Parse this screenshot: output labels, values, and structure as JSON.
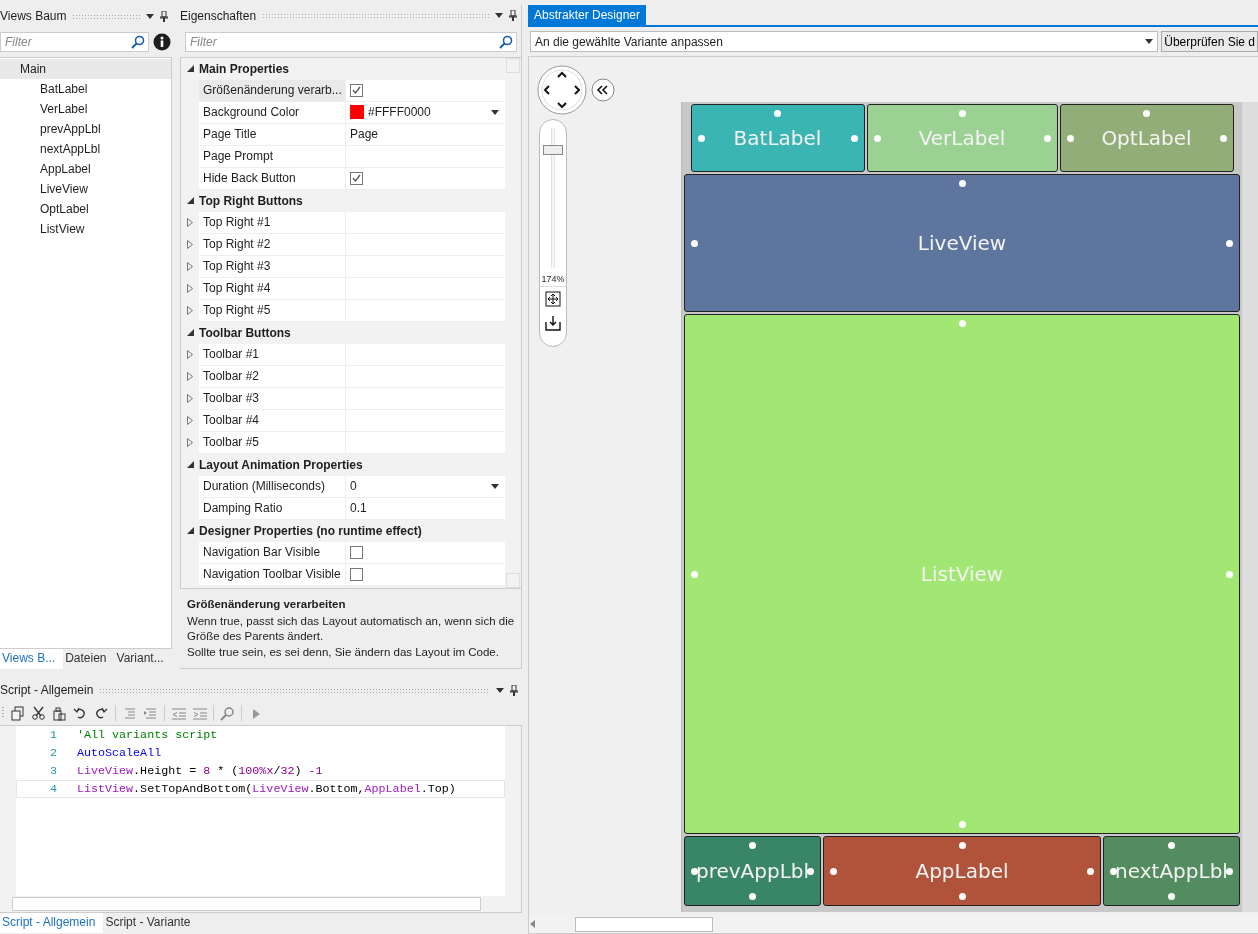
{
  "views_panel": {
    "title": "Views Baum",
    "filter": {
      "placeholder": "Filter"
    },
    "tree": [
      {
        "label": "Main",
        "selected": true,
        "children": [
          {
            "label": "BatLabel",
            "selected": false
          },
          {
            "label": "VerLabel",
            "selected": false
          },
          {
            "label": "prevAppLbl",
            "selected": false
          },
          {
            "label": "nextAppLbl",
            "selected": false
          },
          {
            "label": "AppLabel",
            "selected": false
          },
          {
            "label": "LiveView",
            "selected": false
          },
          {
            "label": "OptLabel",
            "selected": false
          },
          {
            "label": "ListView",
            "selected": false
          }
        ]
      }
    ],
    "tabs": [
      {
        "label": "Views B...",
        "selected": true
      },
      {
        "label": "Dateien",
        "selected": false
      },
      {
        "label": "Variant...",
        "selected": false
      }
    ]
  },
  "properties_panel": {
    "title": "Eigenschaften",
    "filter": {
      "placeholder": "Filter"
    },
    "categories": [
      {
        "name": "Main Properties",
        "expanded": true,
        "rows": [
          {
            "name": "Größenänderung verarb...",
            "kind": "checkbox",
            "checked": true,
            "selected": true
          },
          {
            "name": "Background Color",
            "kind": "color",
            "color": "#ff0000",
            "value": "#FFFF0000",
            "selected": false
          },
          {
            "name": "Page Title",
            "kind": "text",
            "value": "Page",
            "selected": false
          },
          {
            "name": "Page Prompt",
            "kind": "text",
            "selected": false
          },
          {
            "name": "Hide Back Button",
            "kind": "checkbox",
            "checked": true,
            "selected": false
          }
        ]
      },
      {
        "name": "Top Right Buttons",
        "expanded": true,
        "rows": [
          {
            "name": "Top Right #1",
            "kind": "group",
            "expanded": false,
            "selected": false
          },
          {
            "name": "Top Right #2",
            "kind": "group",
            "expanded": false,
            "selected": false
          },
          {
            "name": "Top Right #3",
            "kind": "group",
            "expanded": false,
            "selected": false
          },
          {
            "name": "Top Right #4",
            "kind": "group",
            "expanded": false,
            "selected": false
          },
          {
            "name": "Top Right #5",
            "kind": "group",
            "expanded": false,
            "selected": false
          }
        ]
      },
      {
        "name": "Toolbar Buttons",
        "expanded": true,
        "rows": [
          {
            "name": "Toolbar #1",
            "kind": "group",
            "expanded": false,
            "selected": false
          },
          {
            "name": "Toolbar #2",
            "kind": "group",
            "expanded": false,
            "selected": false
          },
          {
            "name": "Toolbar #3",
            "kind": "group",
            "expanded": false,
            "selected": false
          },
          {
            "name": "Toolbar #4",
            "kind": "group",
            "expanded": false,
            "selected": false
          },
          {
            "name": "Toolbar #5",
            "kind": "group",
            "expanded": false,
            "selected": false
          }
        ]
      },
      {
        "name": "Layout Animation Properties",
        "expanded": true,
        "rows": [
          {
            "name": "Duration (Milliseconds)",
            "kind": "select",
            "value": "0",
            "selected": false
          },
          {
            "name": "Damping Ratio",
            "kind": "text",
            "value": "0.1",
            "selected": false
          }
        ]
      },
      {
        "name": "Designer Properties (no runtime effect)",
        "expanded": true,
        "rows": [
          {
            "name": "Navigation Bar Visible",
            "kind": "checkbox",
            "checked": false,
            "selected": false
          },
          {
            "name": "Navigation Toolbar Visible",
            "kind": "checkbox",
            "checked": false,
            "selected": false
          }
        ]
      }
    ],
    "description": {
      "title": "Größenänderung verarbeiten",
      "lines": [
        "Wenn true, passt sich das Layout automatisch an, wenn sich die Größe des Parents ändert.",
        "Sollte true sein, es sei denn, Sie ändern das Layout im Code."
      ]
    }
  },
  "script_panel": {
    "title": "Script - Allgemein",
    "lines": [
      {
        "number": "1",
        "current": false,
        "tokens": [
          {
            "text": "'All variants script",
            "kind": "comment"
          }
        ]
      },
      {
        "number": "2",
        "current": false,
        "tokens": [
          {
            "text": "AutoScaleAll",
            "kind": "keyword"
          }
        ]
      },
      {
        "number": "3",
        "current": false,
        "tokens": [
          {
            "text": "LiveView",
            "kind": "identifier"
          },
          {
            "text": ".Height = ",
            "kind": "plain"
          },
          {
            "text": "8",
            "kind": "number"
          },
          {
            "text": " * (",
            "kind": "plain"
          },
          {
            "text": "100%x",
            "kind": "number"
          },
          {
            "text": "/",
            "kind": "plain"
          },
          {
            "text": "32",
            "kind": "number"
          },
          {
            "text": ") ",
            "kind": "plain"
          },
          {
            "text": "-1",
            "kind": "number"
          }
        ]
      },
      {
        "number": "4",
        "current": true,
        "tokens": [
          {
            "text": "ListView",
            "kind": "identifier"
          },
          {
            "text": ".SetTopAndBottom(",
            "kind": "plain"
          },
          {
            "text": "LiveView",
            "kind": "identifier"
          },
          {
            "text": ".Bottom,",
            "kind": "plain"
          },
          {
            "text": "AppLabel",
            "kind": "identifier"
          },
          {
            "text": ".Top)",
            "kind": "plain"
          }
        ]
      }
    ],
    "tabs": [
      {
        "label": "Script - Allgemein",
        "selected": true
      },
      {
        "label": "Script - Variante",
        "selected": false
      }
    ]
  },
  "designer": {
    "tab": "Abstrakter Designer",
    "variant_dropdown": {
      "value": "An die gewählte Variante anpassen"
    },
    "check_button": "Überprüfen Sie d",
    "zoom": {
      "level": 0.87,
      "reading": "174%"
    },
    "rows": [
      {
        "views": [
          {
            "name": "BatLabel",
            "color": "#3ab5b3"
          },
          {
            "name": "VerLabel",
            "color": "#9bd193"
          },
          {
            "name": "OptLabel",
            "color": "#93ad79"
          }
        ]
      },
      {
        "views": [
          {
            "name": "LiveView",
            "color": "#5e769e"
          }
        ]
      },
      {
        "views": [
          {
            "name": "ListView",
            "color": "#a2e674"
          }
        ]
      },
      {
        "views": [
          {
            "name": "prevAppLbl",
            "color": "#398567"
          },
          {
            "name": "AppLabel",
            "color": "#b1533b"
          },
          {
            "name": "nextAppLbl",
            "color": "#538c5f"
          }
        ]
      }
    ]
  }
}
